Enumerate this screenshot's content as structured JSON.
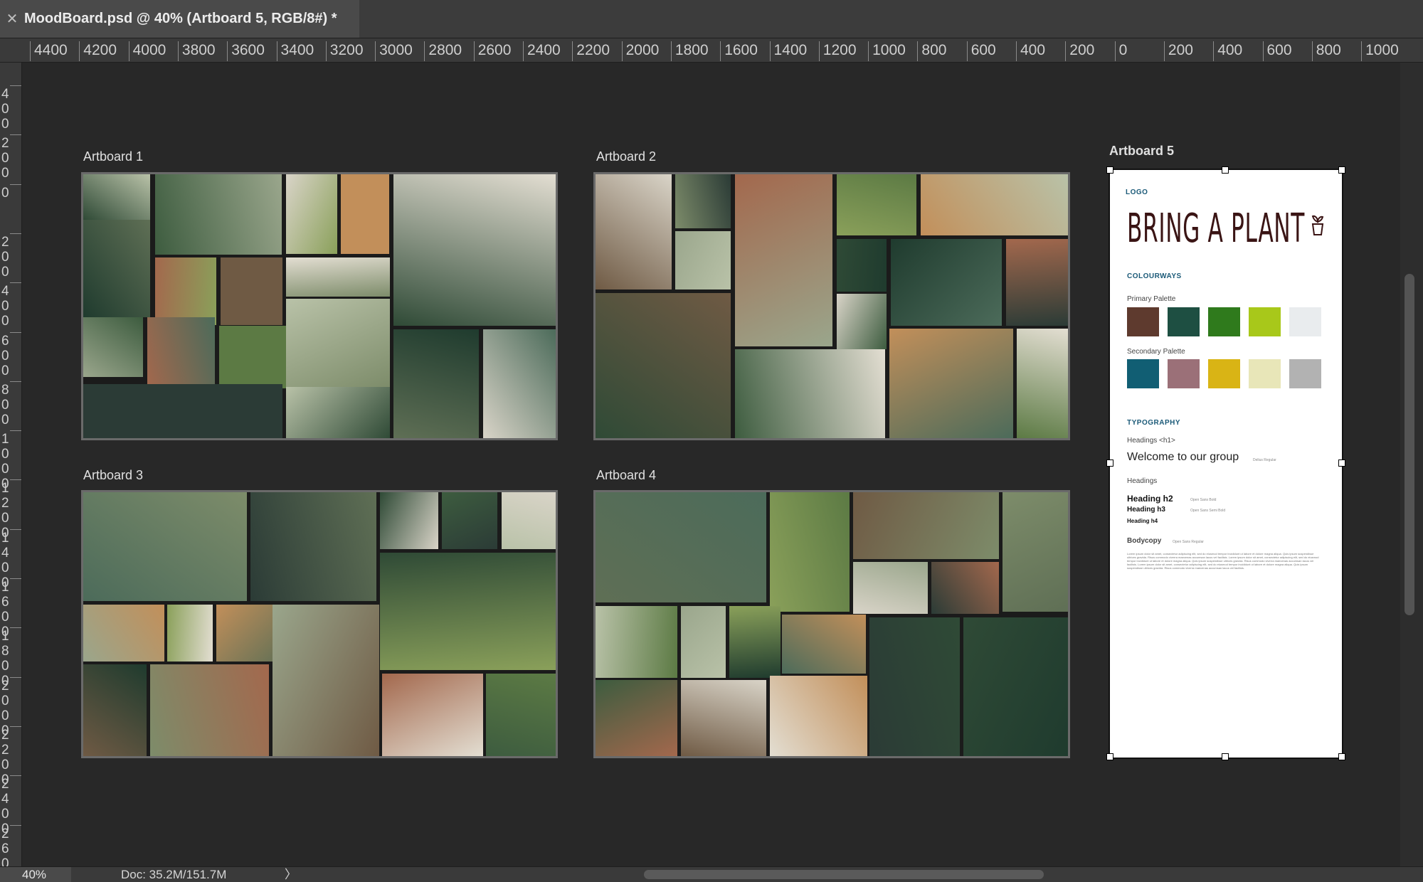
{
  "window": {
    "tab_title": "MoodBoard.psd @ 40% (Artboard 5, RGB/8#) *",
    "close_icon": "close-icon"
  },
  "ruler_top": [
    "4400",
    "4200",
    "4000",
    "3800",
    "3600",
    "3400",
    "3200",
    "3000",
    "2800",
    "2600",
    "2400",
    "2200",
    "2000",
    "1800",
    "1600",
    "1400",
    "1200",
    "1000",
    "800",
    "600",
    "400",
    "200",
    "0",
    "200",
    "400",
    "600",
    "800",
    "1000"
  ],
  "ruler_left": [
    "400",
    "200",
    "0",
    "200",
    "400",
    "600",
    "800",
    "1000",
    "1200",
    "1400",
    "1600",
    "1800",
    "2000",
    "2200",
    "2400",
    "2600"
  ],
  "artboards": {
    "ab1": {
      "title": "Artboard 1"
    },
    "ab2": {
      "title": "Artboard 2"
    },
    "ab3": {
      "title": "Artboard 3"
    },
    "ab4": {
      "title": "Artboard 4"
    },
    "ab5": {
      "title": "Artboard 5",
      "logo_label": "LOGO",
      "brand": "BRING A PLANT",
      "colourways_label": "COLOURWAYS",
      "primary_label": "Primary Palette",
      "primary_colors": [
        "#5e3a2e",
        "#1e4f42",
        "#2f7a1c",
        "#a8c81a",
        "#e9ecee"
      ],
      "secondary_label": "Secondary Palette",
      "secondary_colors": [
        "#115e73",
        "#9b7078",
        "#d9b415",
        "#e8e6b8",
        "#b2b2b2"
      ],
      "typography_label": "TYPOGRAPHY",
      "h1_label": "Headings <h1>",
      "h1_sample": "Welcome to our group",
      "h1_font": "Delius Regular",
      "headings_label": "Headings",
      "h2": "Heading h2",
      "h2_font": "Open Sans Bold",
      "h3": "Heading h3",
      "h3_font": "Open Sans Semi Bold",
      "h4": "Heading h4",
      "body_label": "Bodycopy",
      "body_font": "Open Sans Regular",
      "body_text": "Lorem ipsum dolor sit amet, consectetur adipiscing elit, sed do eiusmod tempor incididunt ut labore et dolore magna aliqua. Quis ipsum suspendisse ultrices gravida. Risus commodo viverra maecenas accumsan lacus vel facilisis. Lorem ipsum dolor sit amet, consectetur adipiscing elit, sed do eiusmod tempor incididunt ut labore et dolore magna aliqua. Quis ipsum suspendisse ultrices gravida. Risus commodo viverra maecenas accumsan lacus vel facilisis. Lorem ipsum dolor sit amet, consectetur adipiscing elit, sed do eiusmod tempor incididunt ut labore et dolore magna aliqua. Quis ipsum suspendisse ultrices gravida. Risus commodo viverra maecenas accumsan lacus vel facilisis."
    }
  },
  "status": {
    "zoom": "40%",
    "doc": "Doc: 35.2M/151.7M",
    "arrow": "〉"
  }
}
